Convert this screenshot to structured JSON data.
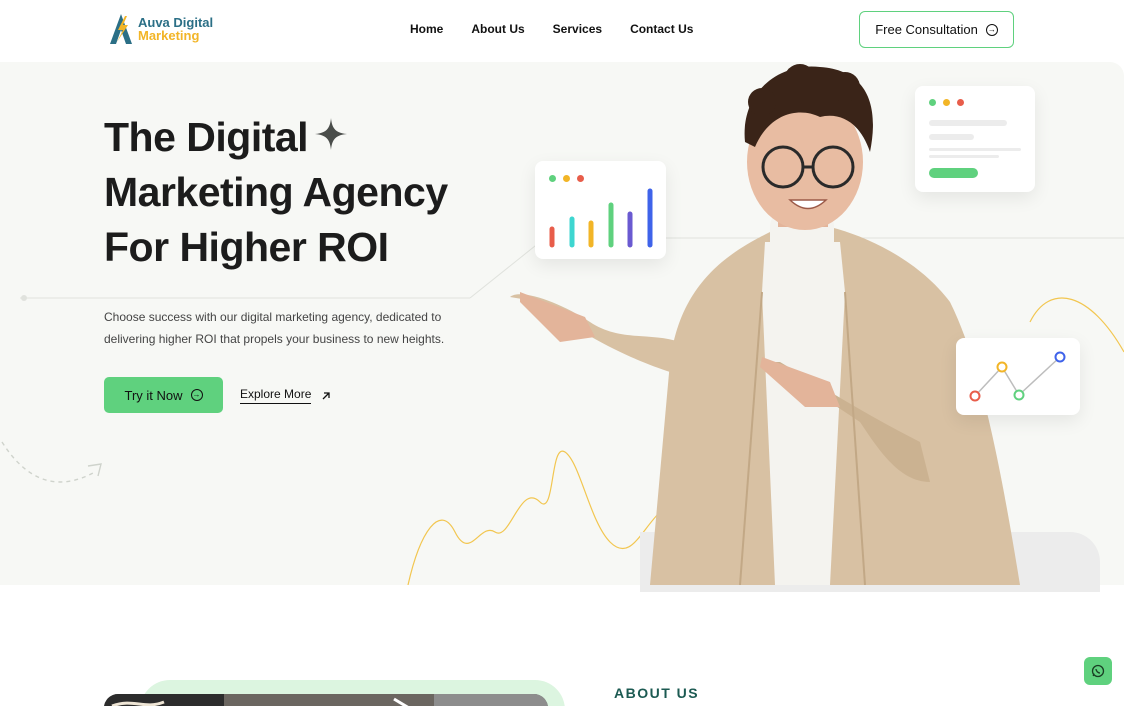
{
  "brand": {
    "line1": "Auva Digital",
    "line2": "Marketing"
  },
  "nav": {
    "items": [
      "Home",
      "About Us",
      "Services",
      "Contact Us"
    ]
  },
  "header": {
    "cta_label": "Free Consultation"
  },
  "hero": {
    "title_line1": "The Digital",
    "title_line2": "Marketing Agency",
    "title_line3_prefix": "For ",
    "title_line3_highlight": "Higher ROI",
    "description": "Choose success with our digital marketing agency, dedicated to delivering higher ROI that propels your business to new heights.",
    "primary_button": "Try it Now",
    "secondary_button": "Explore More"
  },
  "about": {
    "label": "ABOUT US"
  },
  "colors": {
    "accent_green": "#5fd17e",
    "highlight_yellow": "#f9c51f",
    "brand_teal": "#2b6f86",
    "brand_gold": "#f2b527"
  },
  "icons": [
    "arrow-circle-right-icon",
    "arrow-up-right-icon",
    "sparkle-icon",
    "whatsapp-icon"
  ]
}
